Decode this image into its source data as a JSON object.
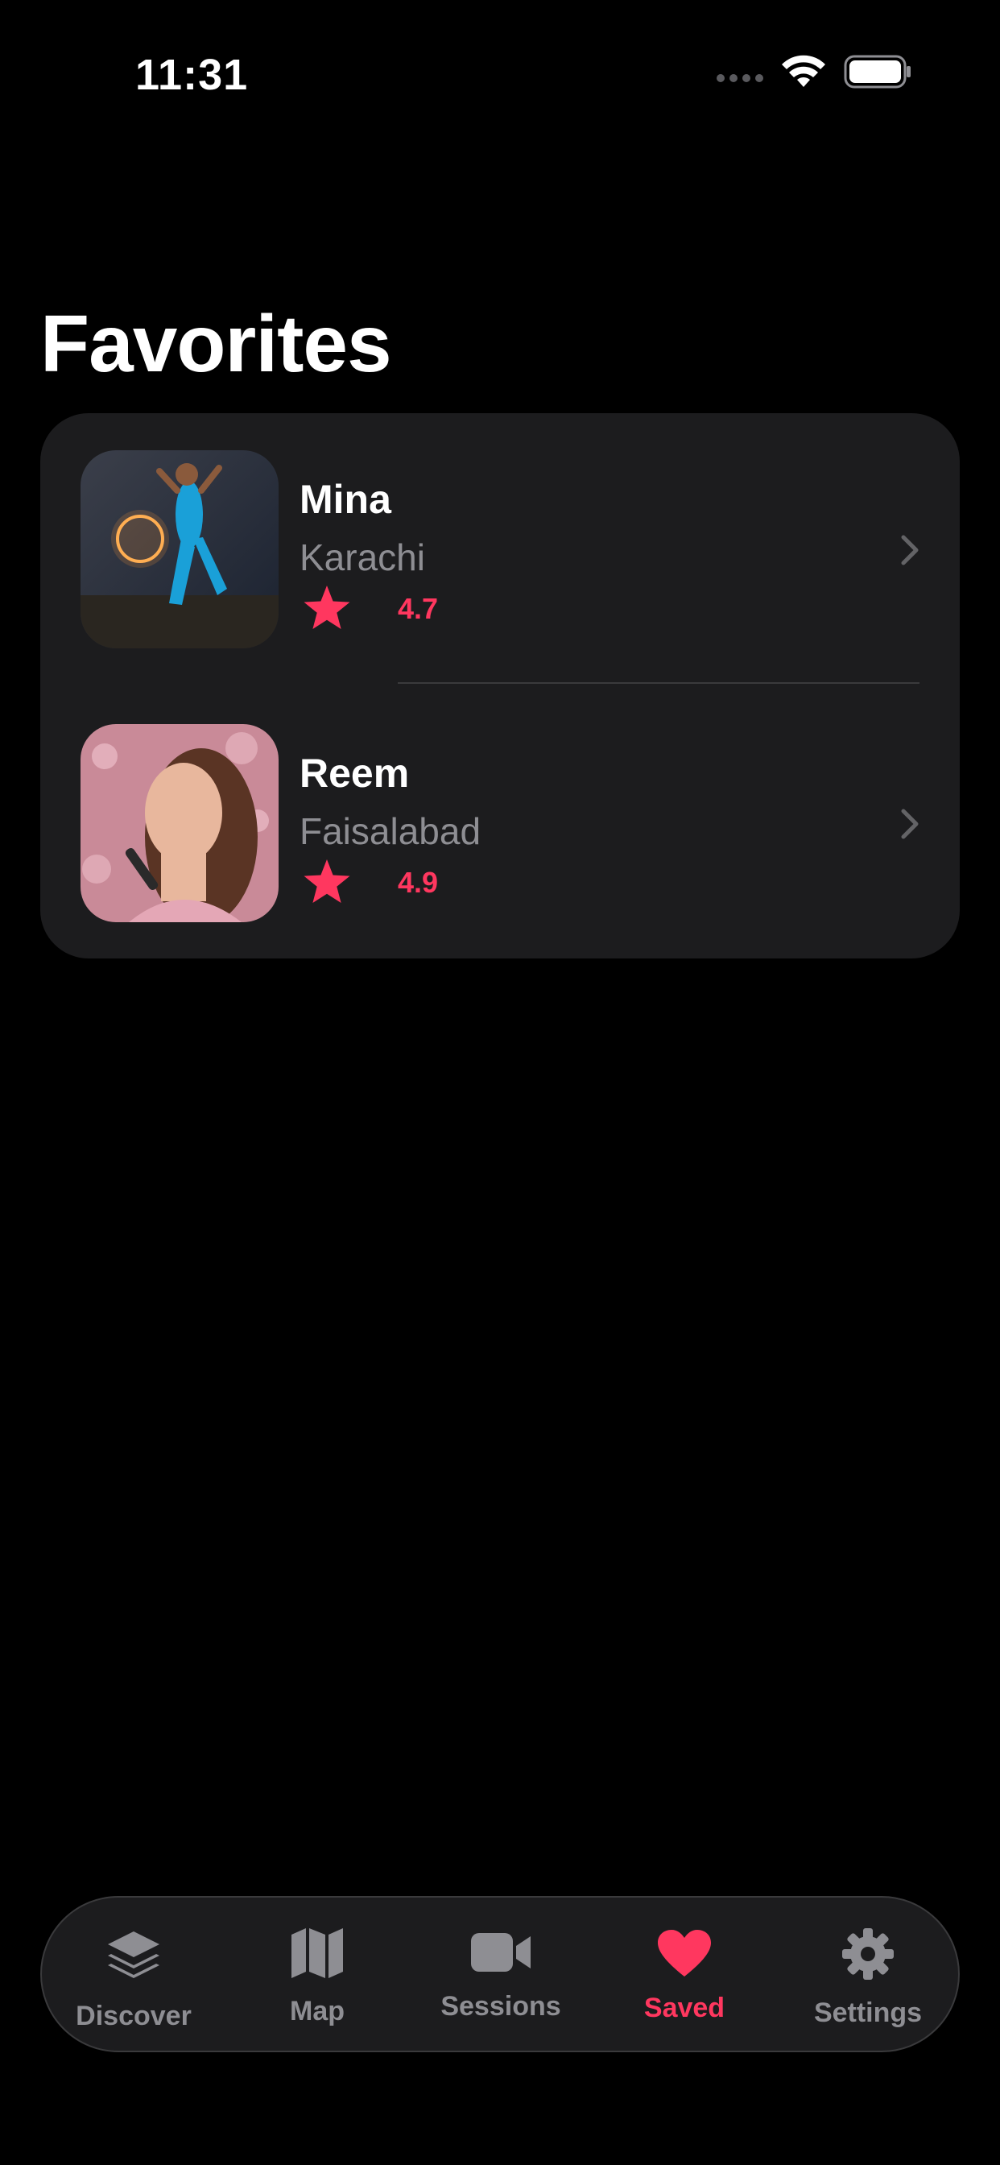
{
  "status": {
    "time": "11:31"
  },
  "page": {
    "title": "Favorites"
  },
  "favorites": [
    {
      "name": "Mina",
      "city": "Karachi",
      "rating": "4.7"
    },
    {
      "name": "Reem",
      "city": "Faisalabad",
      "rating": "4.9"
    }
  ],
  "tabs": [
    {
      "label": "Discover",
      "icon": "stack-icon"
    },
    {
      "label": "Map",
      "icon": "map-icon"
    },
    {
      "label": "Sessions",
      "icon": "video-icon"
    },
    {
      "label": "Saved",
      "icon": "heart-icon",
      "active": true
    },
    {
      "label": "Settings",
      "icon": "gear-icon"
    }
  ],
  "colors": {
    "accent": "#ff375f",
    "background": "#000000",
    "card": "#1c1c1e",
    "secondary_text": "#8e8e93"
  }
}
